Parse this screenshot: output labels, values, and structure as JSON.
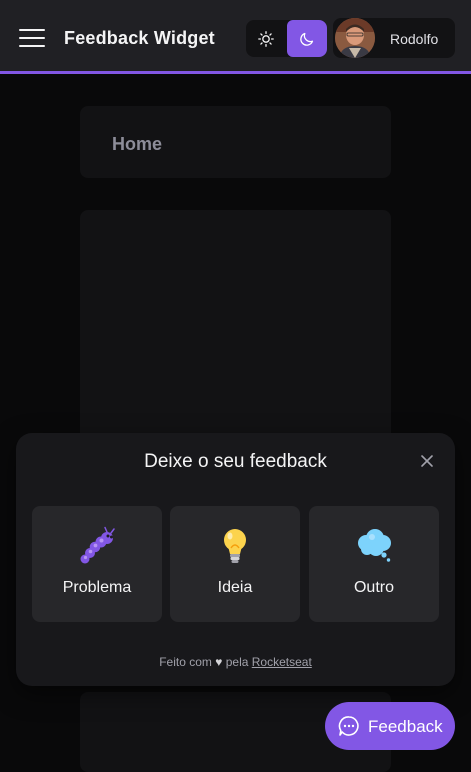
{
  "header": {
    "title": "Feedback Widget",
    "menu_icon": "hamburger-menu-icon",
    "theme": {
      "light_icon": "sun-icon",
      "dark_icon": "moon-icon",
      "active": "dark",
      "accent": "#8257e5"
    },
    "user": {
      "name": "Rodolfo"
    }
  },
  "main": {
    "home_label": "Home"
  },
  "widget": {
    "title": "Deixe o seu feedback",
    "close_icon": "close-icon",
    "types": [
      {
        "label": "Problema",
        "icon": "bug-icon"
      },
      {
        "label": "Ideia",
        "icon": "lightbulb-icon"
      },
      {
        "label": "Outro",
        "icon": "thought-cloud-icon"
      }
    ],
    "footer": {
      "prefix": "Feito com",
      "heart": "♥",
      "middle": "pela",
      "link": "Rocketseat"
    }
  },
  "fab": {
    "label": "Feedback",
    "icon": "chat-bubble-icon"
  }
}
